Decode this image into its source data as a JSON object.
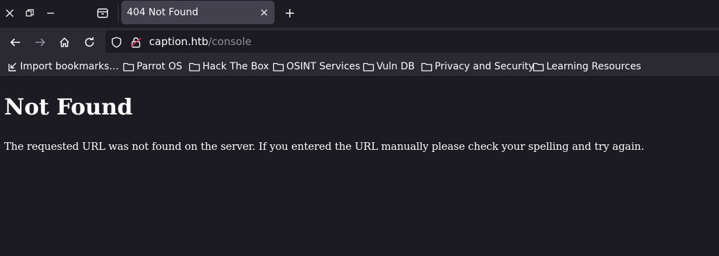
{
  "tab": {
    "title": "404 Not Found"
  },
  "address": {
    "host": "caption.htb",
    "path": "/console"
  },
  "bookmarks": [
    {
      "label": "Import bookmarks…",
      "icon": "import-icon"
    },
    {
      "label": "Parrot OS",
      "icon": "folder-icon"
    },
    {
      "label": "Hack The Box",
      "icon": "folder-icon"
    },
    {
      "label": "OSINT Services",
      "icon": "folder-icon"
    },
    {
      "label": "Vuln DB",
      "icon": "folder-icon"
    },
    {
      "label": "Privacy and Security",
      "icon": "folder-icon"
    },
    {
      "label": "Learning Resources",
      "icon": "folder-icon"
    }
  ],
  "page": {
    "heading": "Not Found",
    "message": "The requested URL was not found on the server. If you entered the URL manually please check your spelling and try again."
  },
  "colors": {
    "background": "#1c1b22",
    "toolbar": "#2b2a33",
    "active_tab": "#42414d",
    "text": "#fbfbfe",
    "muted_text": "#8f8f9d"
  }
}
